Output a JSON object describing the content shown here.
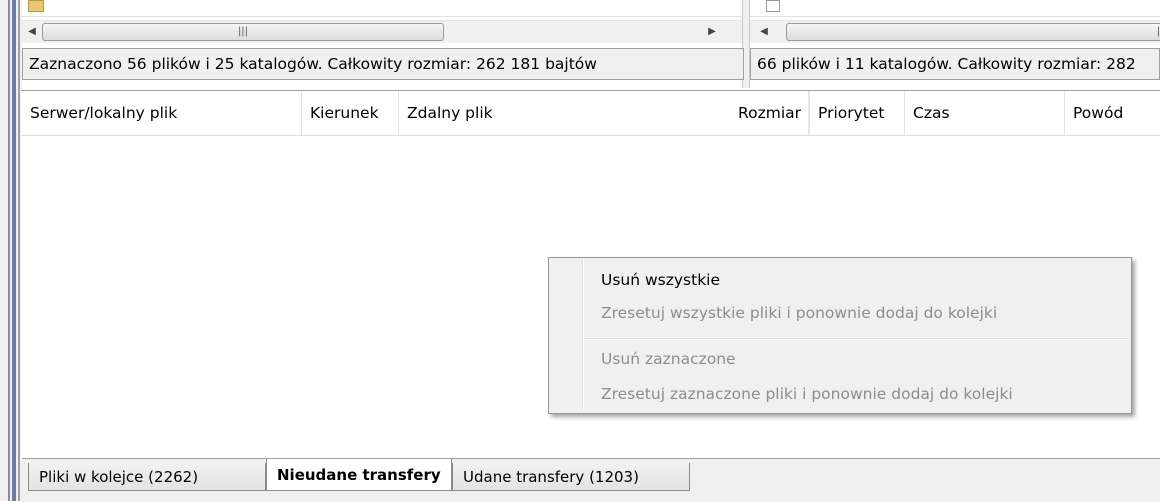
{
  "left_pane": {
    "status_text": "Zaznaczono 56 plików i 25 katalogów. Całkowity rozmiar: 262 181 bajtów"
  },
  "right_pane": {
    "status_text": "66 plików i 11 katalogów. Całkowity rozmiar: 282"
  },
  "queue": {
    "columns": [
      "Serwer/lokalny plik",
      "Kierunek",
      "Zdalny plik",
      "Rozmiar",
      "Priorytet",
      "Czas",
      "Powód"
    ]
  },
  "context_menu": {
    "items": [
      {
        "label": "Usuń wszystkie",
        "enabled": true
      },
      {
        "label": "Zresetuj wszystkie pliki i ponownie dodaj do kolejki",
        "enabled": false
      },
      {
        "label": "Usuń zaznaczone",
        "enabled": false
      },
      {
        "label": "Zresetuj zaznaczone pliki i ponownie dodaj do kolejki",
        "enabled": false
      }
    ]
  },
  "tabs": [
    {
      "label": "Pliki w kolejce (2262)",
      "active": false
    },
    {
      "label": "Nieudane transfery",
      "active": true
    },
    {
      "label": "Udane transfery (1203)",
      "active": false
    }
  ],
  "icons": {
    "scroll_left": "scroll-left-arrow-icon",
    "scroll_right": "scroll-right-arrow-icon",
    "grip": "scrollbar-grip-icon"
  },
  "colors": {
    "window_bg": "#f0f0f0",
    "disabled_text": "#8d8d8d",
    "frame_accent": "#6a7ea0"
  }
}
